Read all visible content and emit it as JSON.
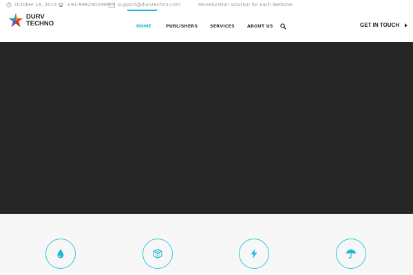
{
  "topbar": {
    "date": "October 18, 2014",
    "phone": "+91-9982902896",
    "email": "support@durvtechno.com",
    "tagline": "Monetization solution for each Website."
  },
  "brand": {
    "line1": "DURV",
    "line2": "TECHNO"
  },
  "nav": {
    "items": [
      {
        "label": "HOME",
        "active": true
      },
      {
        "label": "PUBLISHERS",
        "active": false
      },
      {
        "label": "SERVICES",
        "active": false
      },
      {
        "label": "ABOUT US",
        "active": false
      }
    ]
  },
  "cta": {
    "label": "GET IN TOUCH"
  },
  "features": {
    "icons": [
      "drop-icon",
      "cube-icon",
      "lightning-icon",
      "umbrella-icon"
    ]
  },
  "colors": {
    "accent": "#1fb8d3",
    "hero_bg": "#262626",
    "features_bg": "#f7f7f7"
  }
}
